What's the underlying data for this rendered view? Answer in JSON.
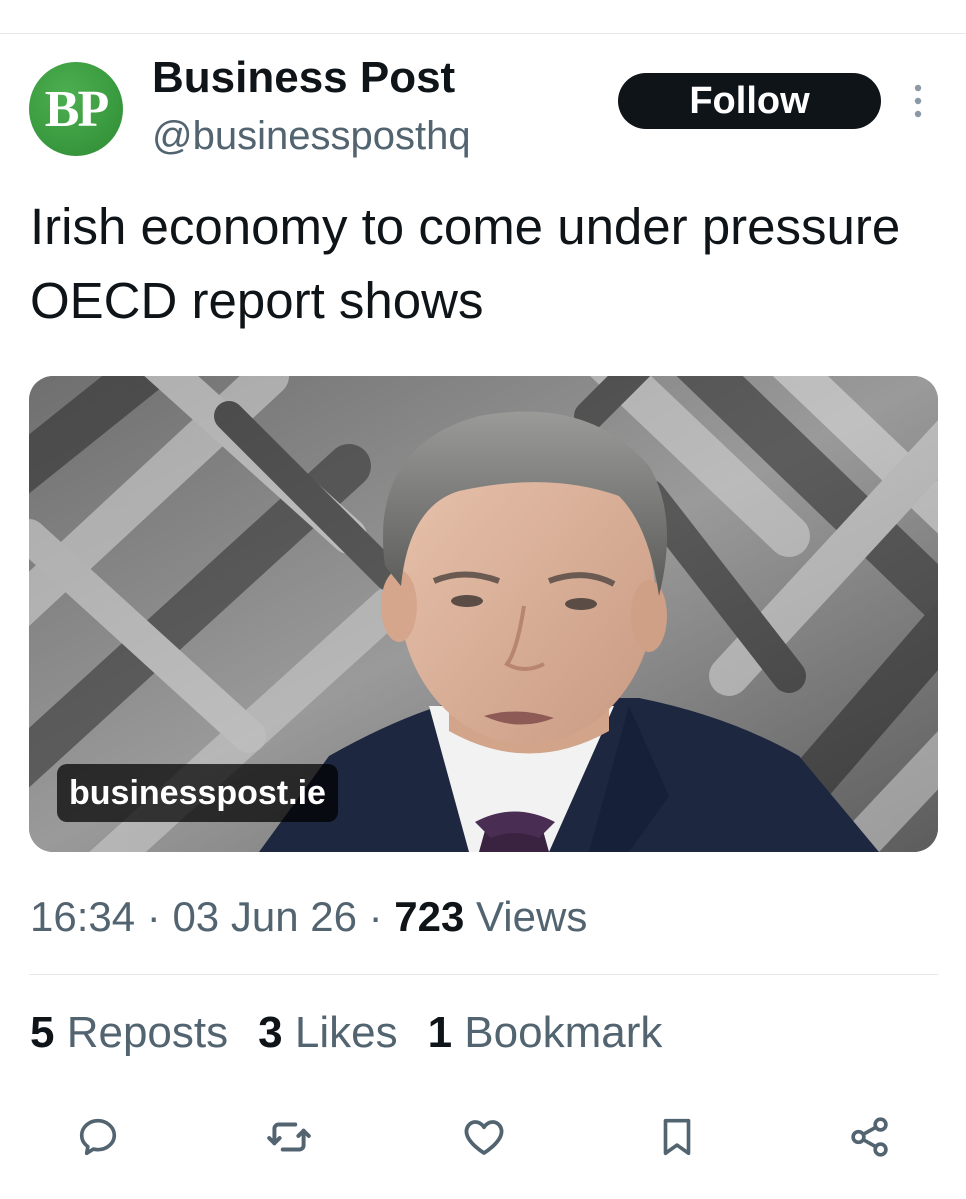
{
  "author": {
    "avatar_text": "BP",
    "display_name": "Business Post",
    "handle": "@businessposthq"
  },
  "follow_button": {
    "label": "Follow"
  },
  "tweet": {
    "text": "Irish economy to come under pressure OECD report shows"
  },
  "media": {
    "domain": "businesspost.ie"
  },
  "meta": {
    "time": "16:34",
    "separator": "·",
    "date": "03 Jun 26",
    "views_count": "723",
    "views_label": "Views"
  },
  "stats": {
    "reposts_count": "5",
    "reposts_label": "Reposts",
    "likes_count": "3",
    "likes_label": "Likes",
    "bookmarks_count": "1",
    "bookmarks_label": "Bookmark"
  },
  "actions": [
    "reply-icon",
    "repost-icon",
    "like-icon",
    "bookmark-icon",
    "share-icon"
  ],
  "colors": {
    "text_primary": "#0f1419",
    "text_secondary": "#536471",
    "avatar_green": "#3a9a3f",
    "follow_bg": "#0f1419",
    "divider": "#e6e9ec"
  }
}
